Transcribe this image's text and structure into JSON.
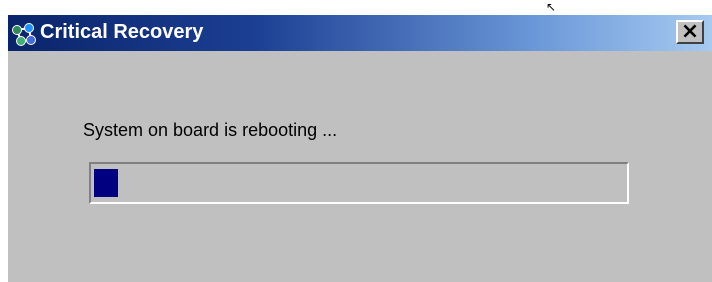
{
  "window": {
    "title": "Critical Recovery",
    "close_glyph": "×",
    "icon": "network-nodes-icon"
  },
  "dialog": {
    "message": "System on board is rebooting ...",
    "progress_fraction": 0.045
  },
  "colors": {
    "titlebar_start": "#0a246a",
    "titlebar_end": "#a6caf0",
    "window_bg": "#c0c0c0",
    "progress_fill": "#000080"
  }
}
